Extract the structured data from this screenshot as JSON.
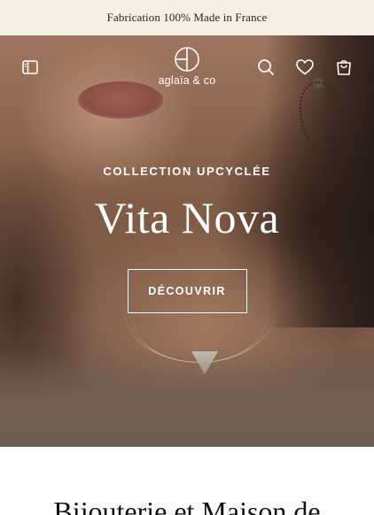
{
  "announcement": {
    "text": "Fabrication 100% Made in France"
  },
  "header": {
    "logo_text": "aglaïa & co",
    "icons": {
      "menu": "sidebar-panel-icon",
      "search": "search-icon",
      "wishlist": "heart-icon",
      "cart": "shopping-bag-icon"
    }
  },
  "hero": {
    "eyebrow": "COLLECTION UPCYCLÉE",
    "title": "Vita Nova",
    "cta_label": "DÉCOUVRIR"
  },
  "section": {
    "heading": "Bijouterie et Maison de"
  },
  "colors": {
    "announcement_bg": "#f6efe6",
    "hero_text": "#ffffff",
    "body_text": "#111111"
  }
}
